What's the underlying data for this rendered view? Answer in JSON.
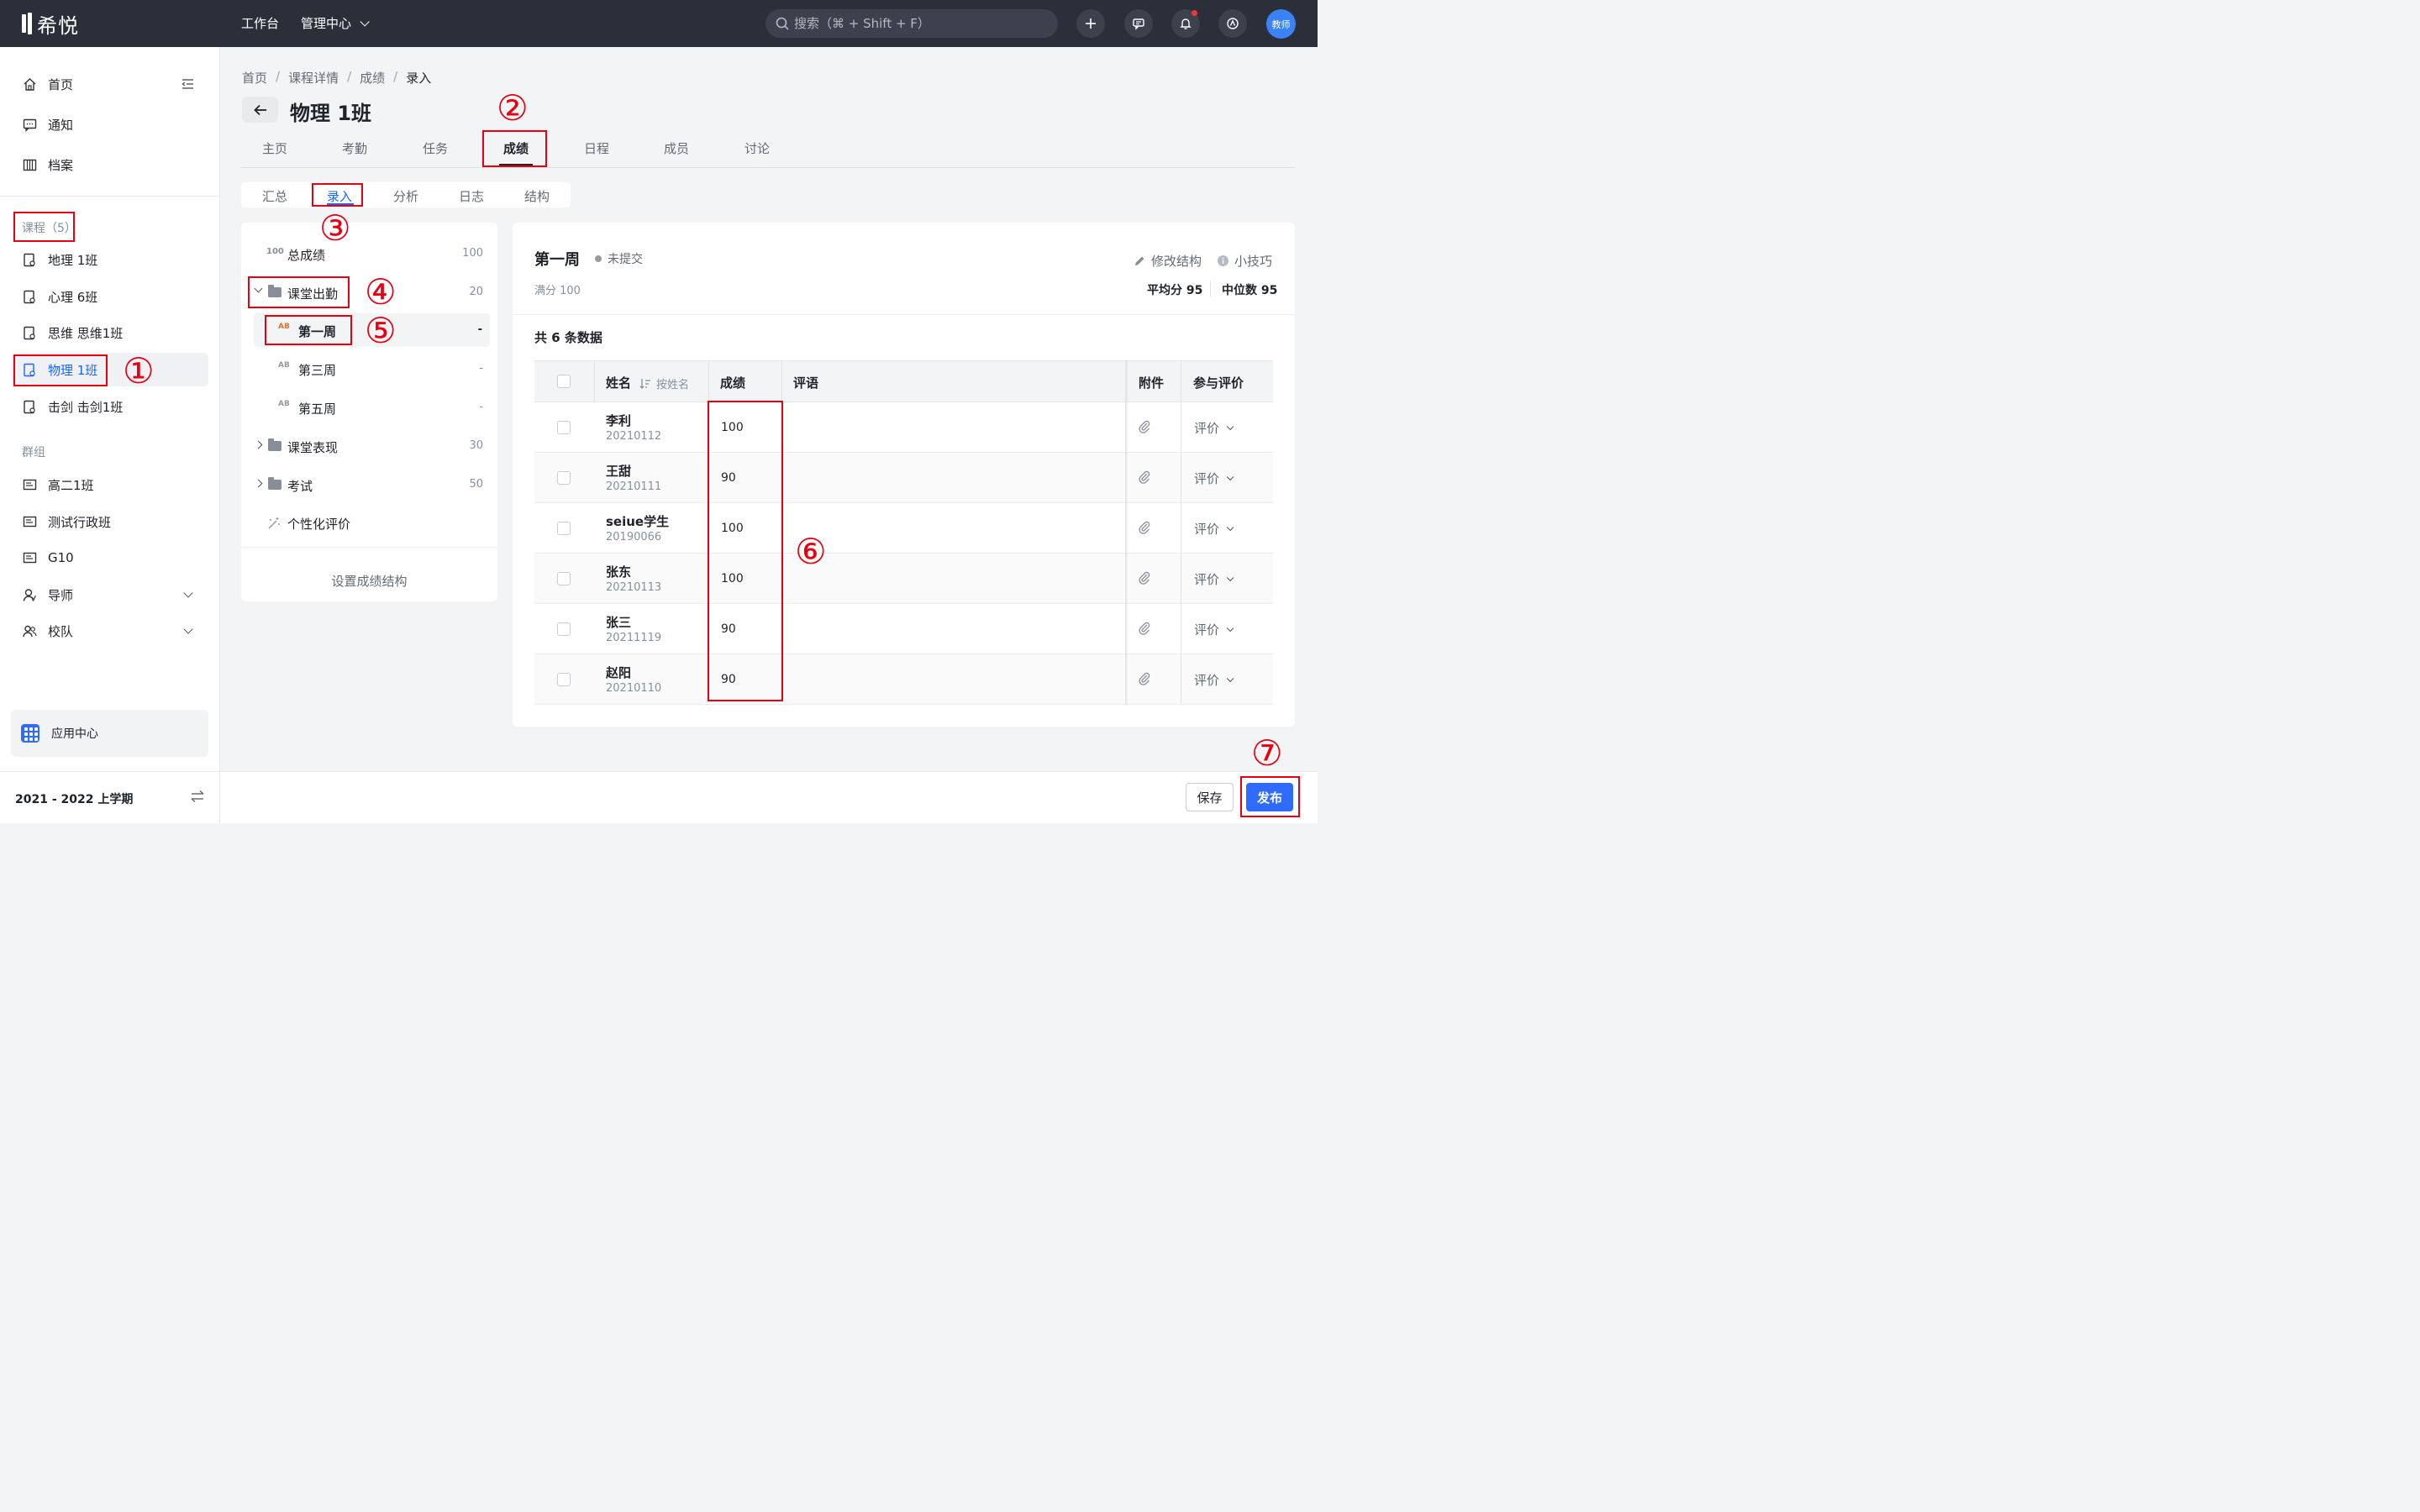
{
  "topbar": {
    "logo_text": "希悦",
    "nav": [
      "工作台",
      "管理中心"
    ],
    "search_placeholder": "搜索（⌘ + Shift + F）",
    "avatar": "教师",
    "colors": {
      "bg": "#2b2f3a",
      "accent": "#2f6bff",
      "notif": "#f0353b"
    }
  },
  "sidebar": {
    "top_items": [
      "首页",
      "通知",
      "档案"
    ],
    "courses_label": "课程（5）",
    "courses": [
      "地理 1班",
      "心理 6班",
      "思维 思维1班",
      "物理 1班",
      "击剑 击剑1班"
    ],
    "groups_label": "群组",
    "groups": [
      "高二1班",
      "测试行政班",
      "G10",
      "导师",
      "校队"
    ],
    "app_center": "应用中心",
    "semester": "2021 - 2022 上学期"
  },
  "breadcrumb": [
    "首页",
    "课程详情",
    "成绩",
    "录入"
  ],
  "page_title": "物理 1班",
  "tabs": [
    "主页",
    "考勤",
    "任务",
    "成绩",
    "日程",
    "成员",
    "讨论"
  ],
  "subtabs": [
    "汇总",
    "录入",
    "分析",
    "日志",
    "结构"
  ],
  "tree": {
    "total_icon": "100",
    "total": {
      "label": "总成绩",
      "value": "100"
    },
    "attendance": {
      "label": "课堂出勤",
      "value": "20"
    },
    "weeks": [
      {
        "label": "第一周",
        "value": "-"
      },
      {
        "label": "第三周",
        "value": "-"
      },
      {
        "label": "第五周",
        "value": "-"
      }
    ],
    "performance": {
      "label": "课堂表现",
      "value": "30"
    },
    "exam": {
      "label": "考试",
      "value": "50"
    },
    "personal": {
      "label": "个性化评价"
    },
    "footer": "设置成绩结构",
    "ab_icon": "AB"
  },
  "card": {
    "title": "第一周",
    "status": "未提交",
    "full_score": "满分 100",
    "edit_structure": "修改结构",
    "tips": "小技巧",
    "avg": "平均分 95",
    "median": "中位数 95",
    "count": "共 6 条数据"
  },
  "table": {
    "headers": {
      "name": "姓名",
      "sort": "按姓名",
      "score": "成绩",
      "comment": "评语",
      "attach": "附件",
      "eval": "参与评价"
    },
    "eval_label": "评价",
    "rows": [
      {
        "name": "李利",
        "id": "20210112",
        "score": "100"
      },
      {
        "name": "王甜",
        "id": "20210111",
        "score": "90"
      },
      {
        "name": "seiue学生",
        "id": "20190066",
        "score": "100"
      },
      {
        "name": "张东",
        "id": "20210113",
        "score": "100"
      },
      {
        "name": "张三",
        "id": "20211119",
        "score": "90"
      },
      {
        "name": "赵阳",
        "id": "20210110",
        "score": "90"
      }
    ]
  },
  "actions": {
    "save": "保存",
    "publish": "发布"
  },
  "annotations": [
    "①",
    "②",
    "③",
    "④",
    "⑤",
    "⑥",
    "⑦"
  ]
}
